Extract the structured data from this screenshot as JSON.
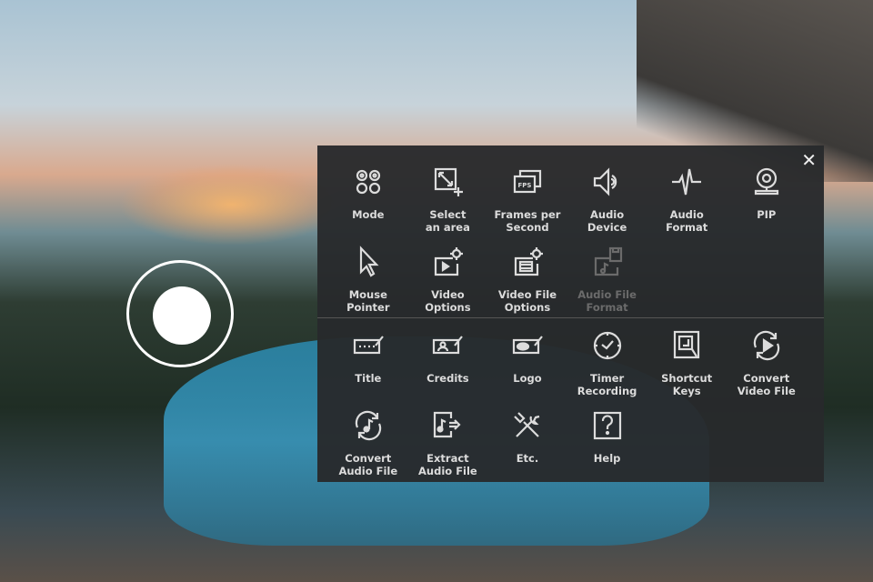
{
  "panel": {
    "close_icon": "close-icon",
    "section1": [
      {
        "label": "Mode",
        "icon": "mode-icon"
      },
      {
        "label": "Select\nan area",
        "icon": "select-area-icon"
      },
      {
        "label": "Frames per\nSecond",
        "icon": "fps-icon",
        "icon_text": "FPS"
      },
      {
        "label": "Audio\nDevice",
        "icon": "speaker-icon"
      },
      {
        "label": "Audio\nFormat",
        "icon": "waveform-icon"
      },
      {
        "label": "PIP",
        "icon": "webcam-icon"
      },
      {
        "label": "Mouse\nPointer",
        "icon": "cursor-icon"
      },
      {
        "label": "Video\nOptions",
        "icon": "video-settings-icon"
      },
      {
        "label": "Video File\nOptions",
        "icon": "video-file-settings-icon"
      },
      {
        "label": "Audio File\nFormat",
        "icon": "audio-file-icon",
        "disabled": true
      }
    ],
    "section2": [
      {
        "label": "Title",
        "icon": "title-icon"
      },
      {
        "label": "Credits",
        "icon": "credits-icon"
      },
      {
        "label": "Logo",
        "icon": "logo-icon"
      },
      {
        "label": "Timer\nRecording",
        "icon": "clock-icon"
      },
      {
        "label": "Shortcut\nKeys",
        "icon": "keyboard-key-icon"
      },
      {
        "label": "Convert\nVideo File",
        "icon": "convert-video-icon"
      },
      {
        "label": "Convert\nAudio File",
        "icon": "convert-audio-icon"
      },
      {
        "label": "Extract\nAudio File",
        "icon": "extract-audio-icon"
      },
      {
        "label": "Etc.",
        "icon": "tools-icon"
      },
      {
        "label": "Help",
        "icon": "help-icon"
      }
    ]
  }
}
